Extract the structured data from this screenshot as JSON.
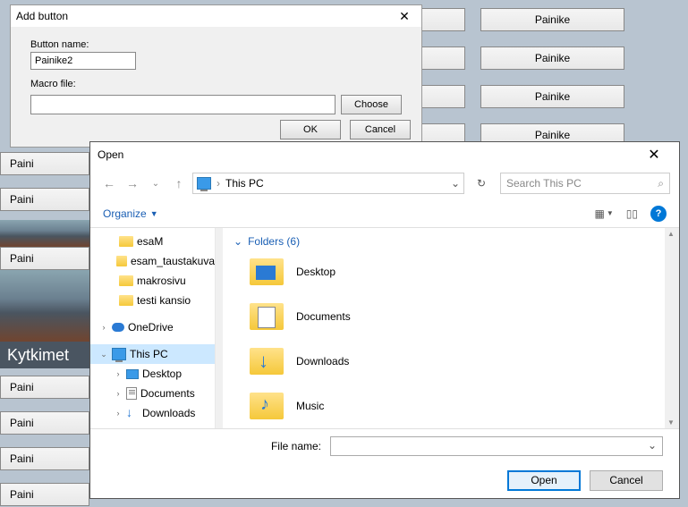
{
  "bg": {
    "button_label": "Painike",
    "left_labels": [
      "Paini",
      "Paini",
      "Paini",
      "Paini",
      "Paini",
      "Paini",
      "Paini",
      "Paini"
    ],
    "section": "Kytkimet"
  },
  "add_dialog": {
    "title": "Add button",
    "button_name_label": "Button name:",
    "button_name_value": "Painike2",
    "macro_label": "Macro file:",
    "choose": "Choose",
    "ok": "OK",
    "cancel": "Cancel"
  },
  "open_dialog": {
    "title": "Open",
    "location": "This PC",
    "search_placeholder": "Search This PC",
    "organize": "Organize",
    "tree": {
      "folders": [
        "esaM",
        "esam_taustakuva",
        "makrosivu",
        "testi kansio"
      ],
      "onedrive": "OneDrive",
      "thispc": "This PC",
      "pc_children": [
        "Desktop",
        "Documents",
        "Downloads"
      ]
    },
    "content": {
      "header": "Folders (6)",
      "items": [
        "Desktop",
        "Documents",
        "Downloads",
        "Music"
      ]
    },
    "file_name_label": "File name:",
    "open_btn": "Open",
    "cancel_btn": "Cancel"
  }
}
